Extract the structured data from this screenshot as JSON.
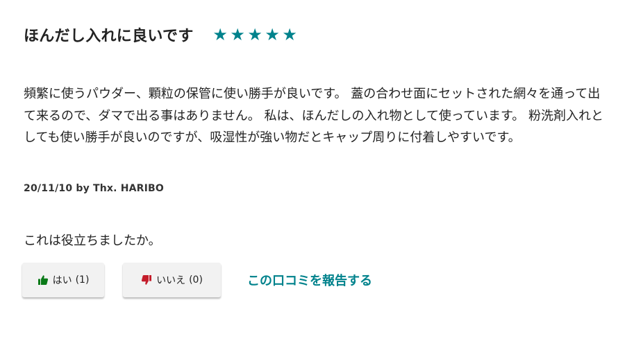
{
  "review": {
    "title": "ほんだし入れに良いです",
    "rating": 5,
    "rating_max": 5,
    "star_glyph": "★",
    "body": "頻繁に使うパウダー、顆粒の保管に使い勝手が良いです。 蓋の合わせ面にセットされた網々を通って出て来るので、ダマで出る事はありません。 私は、ほんだしの入れ物として使っています。 粉洗剤入れとしても使い勝手が良いのですが、吸湿性が強い物だとキャップ周りに付着しやすいです。",
    "meta": "20/11/10 by Thx. HARIBO"
  },
  "helpful": {
    "question": "これは役立ちましたか。",
    "yes_label": "はい",
    "yes_count": "(1)",
    "no_label": "いいえ",
    "no_count": "(0)",
    "report_label": "この口コミを報告する"
  },
  "colors": {
    "accent": "#00828c",
    "thumbs_up": "#0a7a18",
    "thumbs_down": "#c41d2b",
    "button_bg": "#f2f2f2"
  },
  "icons": {
    "star": "star-icon",
    "yes": "thumbs-up-icon",
    "no": "thumbs-down-icon"
  }
}
